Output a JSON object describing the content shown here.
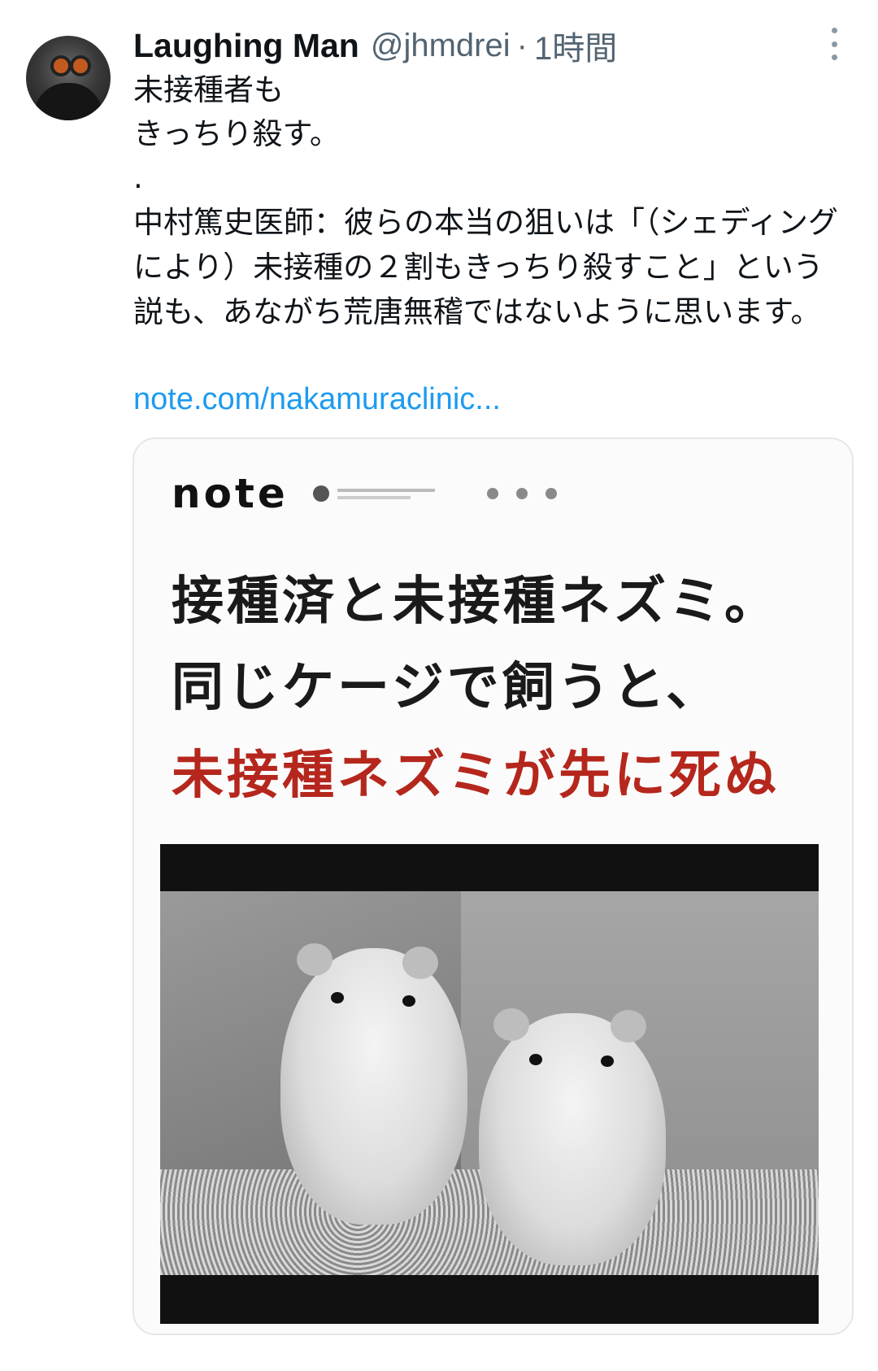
{
  "tweet": {
    "display_name": "Laughing Man",
    "handle": "@jhmdrei",
    "separator": "·",
    "time": "1時間",
    "lines": [
      "未接種者も",
      "きっちり殺す。",
      "."
    ],
    "paragraph": "中村篤史医師：彼らの本当の狙いは「（シェディングにより）未接種の２割もきっちり殺すこと」という説も、あながち荒唐無稽ではないように思います。",
    "link_text": "note.com/nakamuraclinic..."
  },
  "card": {
    "logo": "note",
    "headline_lines": [
      "接種済と未接種ネズミ。",
      "同じケージで飼うと、",
      "未接種ネズミが先に死ぬ"
    ],
    "headline_accent_color": "#b5271d"
  },
  "icons": {
    "more": "more-vertical-icon",
    "share": [
      "twitter-icon",
      "facebook-icon",
      "pocket-icon"
    ]
  },
  "colors": {
    "link": "#1d9bf0",
    "secondary_text": "#536471"
  }
}
